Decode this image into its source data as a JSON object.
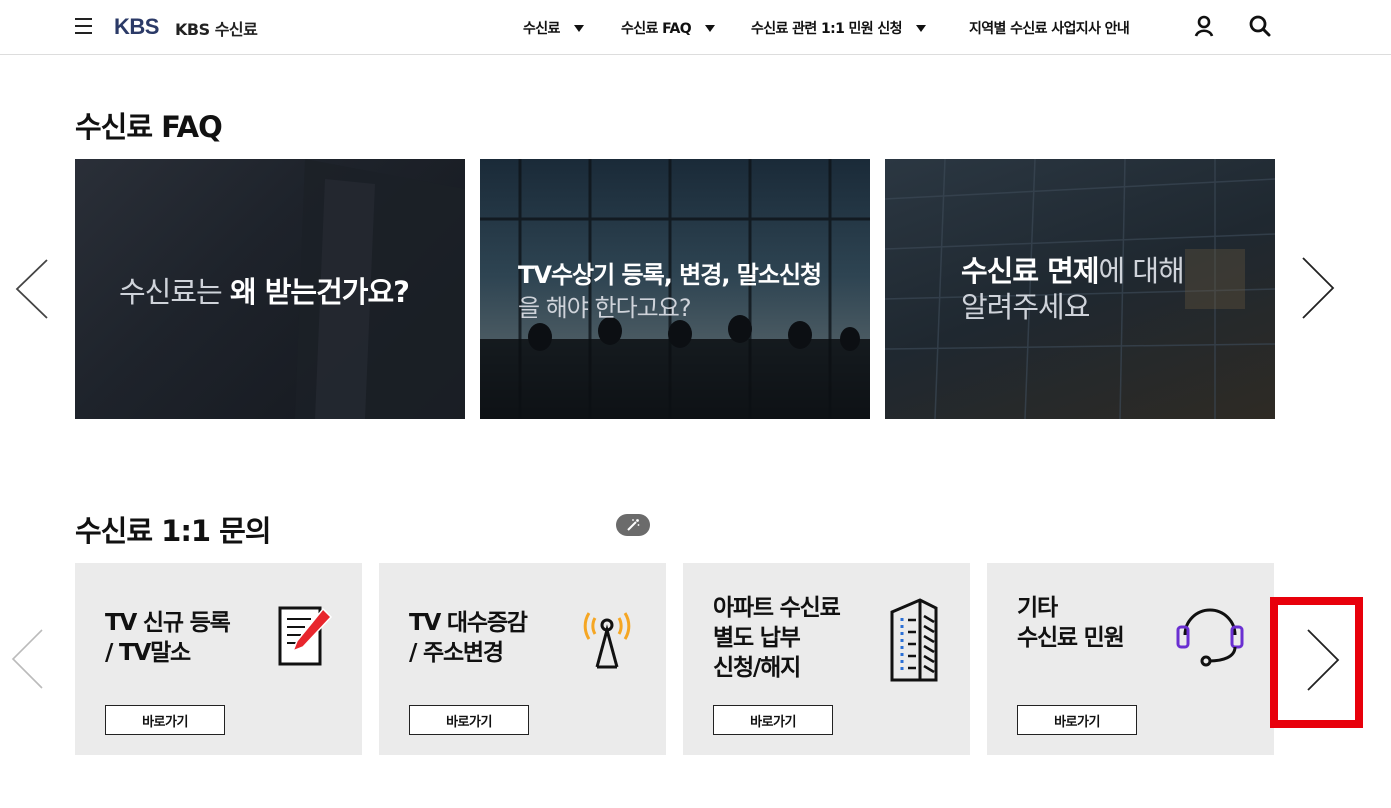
{
  "header": {
    "logo": "KBS",
    "site_name": "KBS 수신료",
    "nav": [
      {
        "label": "수신료"
      },
      {
        "label": "수신료 FAQ"
      },
      {
        "label": "수신료 관련 1:1 민원 신청"
      },
      {
        "label": "지역별 수신료 사업지사 안내"
      }
    ],
    "icons": [
      "menu-icon",
      "user-icon",
      "search-icon"
    ]
  },
  "faq": {
    "title": "수신료 FAQ",
    "cards": [
      {
        "light": "수신료는 ",
        "bold": "왜 받는건가요?"
      },
      {
        "bold": "TV수상기 등록, 변경, 말소신청",
        "light": "을 해야 한다고요?"
      },
      {
        "bold": "수신료 면제",
        "light": "에 대해",
        "light2": "알려주세요"
      }
    ]
  },
  "inquiry": {
    "title": "수신료 1:1 문의",
    "cards": [
      {
        "title": "TV 신규 등록\n/ TV말소",
        "button": "바로가기",
        "icon": "pencil-document-icon"
      },
      {
        "title": "TV 대수증감\n/ 주소변경",
        "button": "바로가기",
        "icon": "antenna-icon"
      },
      {
        "title": "아파트 수신료\n별도 납부\n신청/해지",
        "button": "바로가기",
        "icon": "building-icon"
      },
      {
        "title": "기타\n수신료 민원",
        "button": "바로가기",
        "icon": "headset-icon"
      }
    ]
  },
  "colors": {
    "logo": "#2b3a67",
    "card_bg": "#ebebeb",
    "highlight": "#e8000b",
    "antenna": "#f5a623",
    "headset": "#6a2fd1",
    "building_accent": "#2a6fd6",
    "pencil": "#e8262d"
  }
}
